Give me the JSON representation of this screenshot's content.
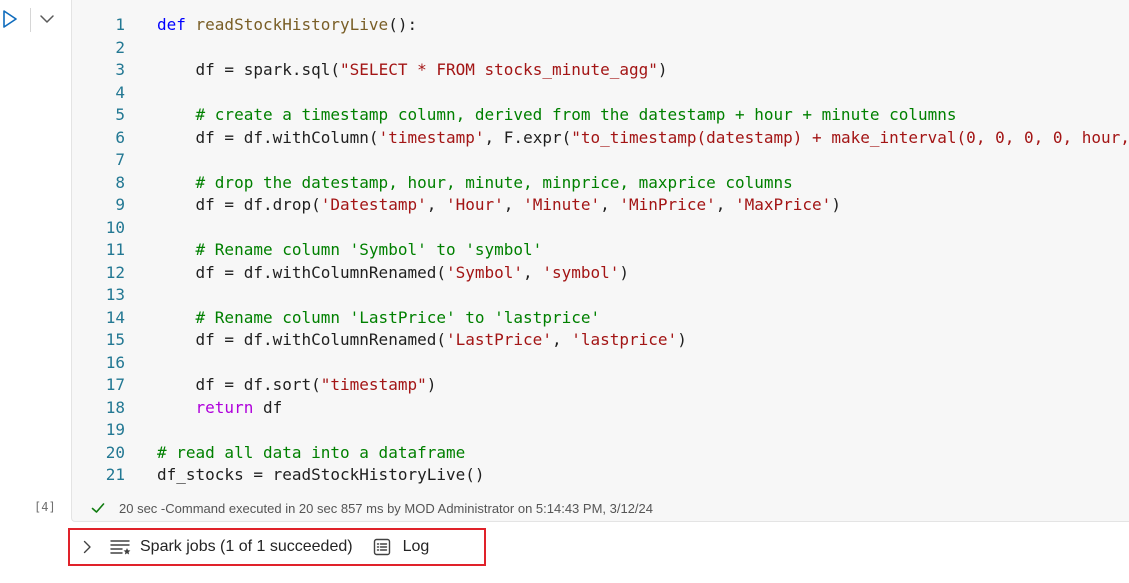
{
  "cell": {
    "run_icon": "play-icon",
    "collapse_icon": "chevron-down-icon",
    "execution_count": "[4]",
    "status_text": "20 sec -Command executed in 20 sec 857 ms by MOD Administrator on 5:14:43 PM, 3/12/24",
    "status_icon": "checkmark-icon",
    "lines": [
      {
        "n": "1",
        "tokens": [
          [
            "kw",
            "def "
          ],
          [
            "fn",
            "readStockHistoryLive"
          ],
          [
            "plain",
            "():"
          ]
        ]
      },
      {
        "n": "2",
        "tokens": []
      },
      {
        "n": "3",
        "tokens": [
          [
            "plain",
            "    df = spark.sql("
          ],
          [
            "str",
            "\"SELECT * FROM stocks_minute_agg\""
          ],
          [
            "plain",
            ")"
          ]
        ]
      },
      {
        "n": "4",
        "tokens": []
      },
      {
        "n": "5",
        "tokens": [
          [
            "cmt",
            "    # create a timestamp column, derived from the datestamp + hour + minute columns"
          ]
        ]
      },
      {
        "n": "6",
        "tokens": [
          [
            "plain",
            "    df = df.withColumn("
          ],
          [
            "str",
            "'timestamp'"
          ],
          [
            "plain",
            ", F.expr("
          ],
          [
            "str",
            "\"to_timestamp(datestamp) + make_interval(0, 0, 0, 0, hour,"
          ]
        ]
      },
      {
        "n": "7",
        "tokens": []
      },
      {
        "n": "8",
        "tokens": [
          [
            "cmt",
            "    # drop the datestamp, hour, minute, minprice, maxprice columns"
          ]
        ]
      },
      {
        "n": "9",
        "tokens": [
          [
            "plain",
            "    df = df.drop("
          ],
          [
            "str",
            "'Datestamp'"
          ],
          [
            "plain",
            ", "
          ],
          [
            "str",
            "'Hour'"
          ],
          [
            "plain",
            ", "
          ],
          [
            "str",
            "'Minute'"
          ],
          [
            "plain",
            ", "
          ],
          [
            "str",
            "'MinPrice'"
          ],
          [
            "plain",
            ", "
          ],
          [
            "str",
            "'MaxPrice'"
          ],
          [
            "plain",
            ")"
          ]
        ]
      },
      {
        "n": "10",
        "tokens": []
      },
      {
        "n": "11",
        "tokens": [
          [
            "cmt",
            "    # Rename column 'Symbol' to 'symbol'"
          ]
        ]
      },
      {
        "n": "12",
        "tokens": [
          [
            "plain",
            "    df = df.withColumnRenamed("
          ],
          [
            "str",
            "'Symbol'"
          ],
          [
            "plain",
            ", "
          ],
          [
            "str",
            "'symbol'"
          ],
          [
            "plain",
            ")"
          ]
        ]
      },
      {
        "n": "13",
        "tokens": []
      },
      {
        "n": "14",
        "tokens": [
          [
            "cmt",
            "    # Rename column 'LastPrice' to 'lastprice'"
          ]
        ]
      },
      {
        "n": "15",
        "tokens": [
          [
            "plain",
            "    df = df.withColumnRenamed("
          ],
          [
            "str",
            "'LastPrice'"
          ],
          [
            "plain",
            ", "
          ],
          [
            "str",
            "'lastprice'"
          ],
          [
            "plain",
            ")"
          ]
        ]
      },
      {
        "n": "16",
        "tokens": []
      },
      {
        "n": "17",
        "tokens": [
          [
            "plain",
            "    df = df.sort("
          ],
          [
            "str",
            "\"timestamp\""
          ],
          [
            "plain",
            ")"
          ]
        ]
      },
      {
        "n": "18",
        "tokens": [
          [
            "ctrl",
            "    return"
          ],
          [
            "plain",
            " df"
          ]
        ]
      },
      {
        "n": "19",
        "tokens": []
      },
      {
        "n": "20",
        "tokens": [
          [
            "cmt",
            "# read all data into a dataframe"
          ]
        ]
      },
      {
        "n": "21",
        "tokens": [
          [
            "plain",
            "df_stocks = readStockHistoryLive()"
          ]
        ]
      }
    ]
  },
  "jobs_bar": {
    "expand_icon": "chevron-right-icon",
    "jobs_icon": "spark-jobs-icon",
    "jobs_label": "Spark jobs (1 of 1 succeeded)",
    "log_icon": "log-icon",
    "log_label": "Log",
    "highlight_color": "#e0222a"
  },
  "colors": {
    "keyword": "#0000ff",
    "function": "#795e26",
    "string": "#a31515",
    "comment": "#008000",
    "control": "#af00db",
    "line_number": "#237893",
    "success": "#107c10",
    "run_button": "#0f6cbd"
  }
}
